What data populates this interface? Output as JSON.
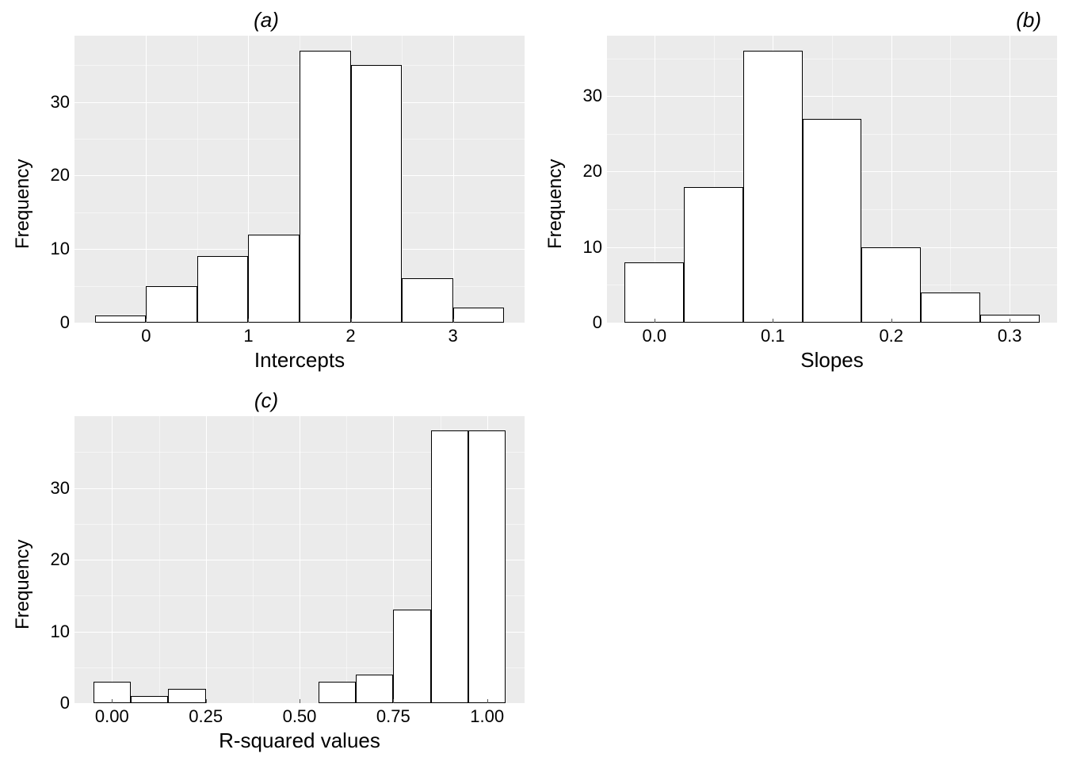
{
  "chart_data": [
    {
      "id": "a",
      "type": "bar",
      "title": "(a)",
      "xlabel": "Intercepts",
      "ylabel": "Frequency",
      "bins": [
        {
          "start": -0.5,
          "end": 0.0,
          "count": 1
        },
        {
          "start": 0.0,
          "end": 0.5,
          "count": 5
        },
        {
          "start": 0.5,
          "end": 1.0,
          "count": 9
        },
        {
          "start": 1.0,
          "end": 1.5,
          "count": 12
        },
        {
          "start": 1.5,
          "end": 2.0,
          "count": 37
        },
        {
          "start": 2.0,
          "end": 2.5,
          "count": 35
        },
        {
          "start": 2.5,
          "end": 3.0,
          "count": 6
        },
        {
          "start": 3.0,
          "end": 3.5,
          "count": 2
        }
      ],
      "xlim": [
        -0.7,
        3.7
      ],
      "ylim": [
        0,
        39
      ],
      "xticks": [
        0,
        1,
        2,
        3
      ],
      "yticks": [
        0,
        10,
        20,
        30
      ]
    },
    {
      "id": "b",
      "type": "bar",
      "title": "(b)",
      "xlabel": "Slopes",
      "ylabel": "Frequency",
      "bins": [
        {
          "start": -0.025,
          "end": 0.025,
          "count": 8
        },
        {
          "start": 0.025,
          "end": 0.075,
          "count": 18
        },
        {
          "start": 0.075,
          "end": 0.125,
          "count": 36
        },
        {
          "start": 0.125,
          "end": 0.175,
          "count": 27
        },
        {
          "start": 0.175,
          "end": 0.225,
          "count": 10
        },
        {
          "start": 0.225,
          "end": 0.275,
          "count": 4
        },
        {
          "start": 0.275,
          "end": 0.325,
          "count": 1
        }
      ],
      "xlim": [
        -0.04,
        0.34
      ],
      "ylim": [
        0,
        38
      ],
      "xticks": [
        0.0,
        0.1,
        0.2,
        0.3
      ],
      "yticks": [
        0,
        10,
        20,
        30
      ]
    },
    {
      "id": "c",
      "type": "bar",
      "title": "(c)",
      "xlabel": "R-squared values",
      "ylabel": "Frequency",
      "bins": [
        {
          "start": -0.05,
          "end": 0.05,
          "count": 3
        },
        {
          "start": 0.05,
          "end": 0.15,
          "count": 1
        },
        {
          "start": 0.15,
          "end": 0.25,
          "count": 2
        },
        {
          "start": 0.25,
          "end": 0.35,
          "count": 0
        },
        {
          "start": 0.35,
          "end": 0.45,
          "count": 0
        },
        {
          "start": 0.45,
          "end": 0.55,
          "count": 0
        },
        {
          "start": 0.55,
          "end": 0.65,
          "count": 3
        },
        {
          "start": 0.65,
          "end": 0.75,
          "count": 4
        },
        {
          "start": 0.75,
          "end": 0.85,
          "count": 13
        },
        {
          "start": 0.85,
          "end": 0.95,
          "count": 38
        },
        {
          "start": 0.95,
          "end": 1.05,
          "count": 38
        }
      ],
      "xlim": [
        -0.1,
        1.1
      ],
      "ylim": [
        0,
        40
      ],
      "xticks": [
        0.0,
        0.25,
        0.5,
        0.75,
        1.0
      ],
      "yticks": [
        0,
        10,
        20,
        30
      ]
    }
  ]
}
